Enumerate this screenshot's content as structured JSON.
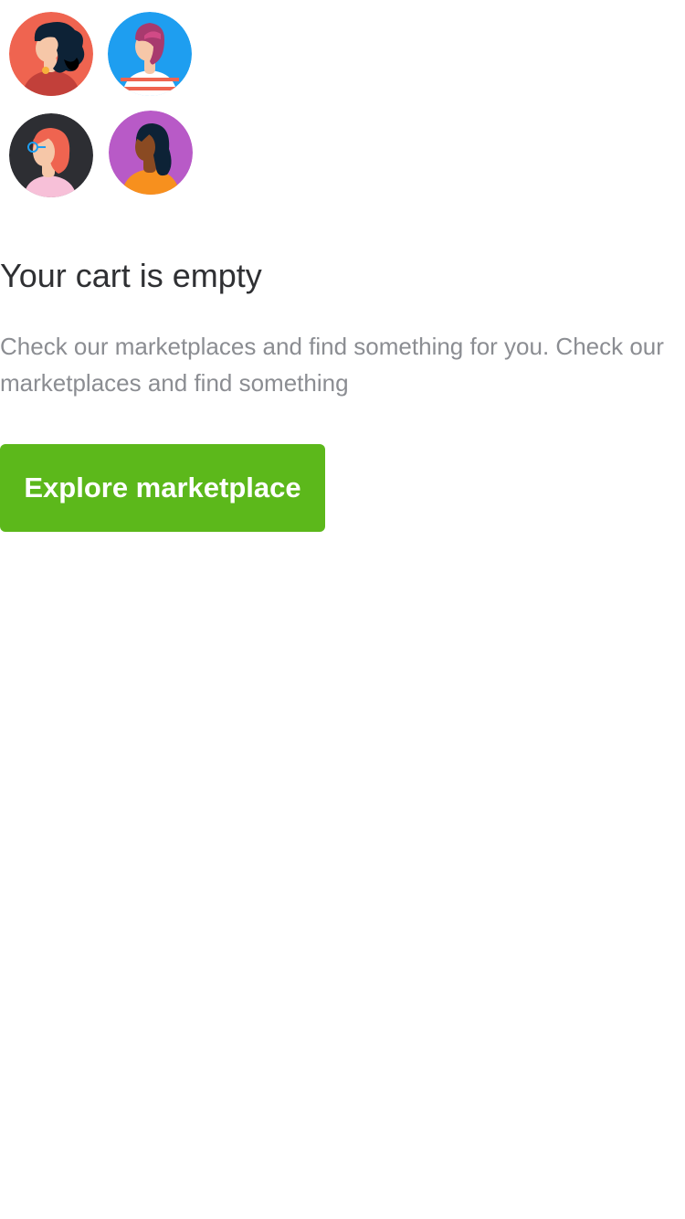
{
  "avatars": [
    {
      "name": "avatar-curly-hair",
      "bg_color": "#ef6450"
    },
    {
      "name": "avatar-bearded-man",
      "bg_color": "#1e9ef0"
    },
    {
      "name": "avatar-glasses-woman",
      "bg_color": "#2d2e33"
    },
    {
      "name": "avatar-long-hair-woman",
      "bg_color": "#b85ac7"
    }
  ],
  "empty_state": {
    "title": "Your cart is empty",
    "description": "Check our marketplaces and find something for you. Check our marketplaces and find something",
    "button_label": "Explore marketplace"
  },
  "colors": {
    "accent": "#5cb81b",
    "title_text": "#2f3033",
    "body_text": "#8b8d92",
    "background": "#ffffff"
  }
}
